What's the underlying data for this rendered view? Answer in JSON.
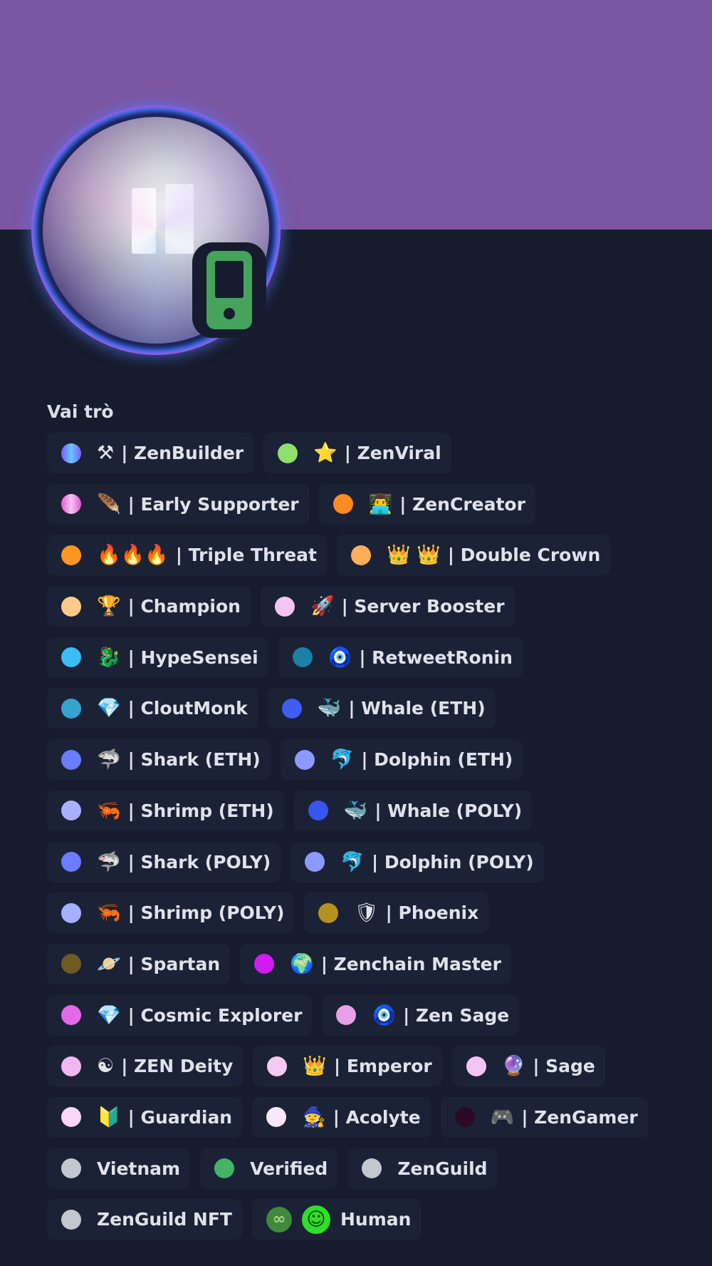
{
  "profile": {
    "section_title": "Vai trò",
    "colors": {
      "banner": "#7c56a0",
      "background": "#161c2d",
      "status_mobile": "#46a35b"
    }
  },
  "roles": [
    {
      "emoji": "⚒",
      "label": "| ZenBuilder",
      "dot": "linear-gradient(90deg,#7c5cff,#66c7ff,#7c5cff)"
    },
    {
      "emoji": "⭐",
      "label": "| ZenViral",
      "dot": "#8fe06a"
    },
    {
      "emoji": "🪶",
      "label": "| Early Supporter",
      "dot": "linear-gradient(90deg,#e45ad6,#f8c4f0,#e45ad6)"
    },
    {
      "emoji": "👨‍💻",
      "label": "| ZenCreator",
      "dot": "#ff8a1e"
    },
    {
      "emoji": "🔥🔥🔥",
      "label": "| Triple Threat",
      "dot": "#ff9523"
    },
    {
      "emoji": "👑 👑",
      "label": "| Double Crown",
      "dot": "#ffae5a"
    },
    {
      "emoji": "🏆",
      "label": "| Champion",
      "dot": "#ffc98a"
    },
    {
      "emoji": "🚀",
      "label": "| Server Booster",
      "dot": "#f5c3f1"
    },
    {
      "emoji": "🐉",
      "label": "| HypeSensei",
      "dot": "#3cbdf4"
    },
    {
      "emoji": "🧿",
      "label": "| RetweetRonin",
      "dot": "#1c7fa6"
    },
    {
      "emoji": "💎",
      "label": "| CloutMonk",
      "dot": "#36a3cf"
    },
    {
      "emoji": "🐳",
      "label": "| Whale (ETH)",
      "dot": "#3f5cf5"
    },
    {
      "emoji": "🦈",
      "label": "| Shark (ETH)",
      "dot": "#6a7cff"
    },
    {
      "emoji": "🐬",
      "label": "| Dolphin (ETH)",
      "dot": "#8c9aff"
    },
    {
      "emoji": "🦐",
      "label": "| Shrimp (ETH)",
      "dot": "#a6b0ff"
    },
    {
      "emoji": "🐳",
      "label": "| Whale (POLY)",
      "dot": "#3a55ee"
    },
    {
      "emoji": "🦈",
      "label": "| Shark (POLY)",
      "dot": "#6a7cff"
    },
    {
      "emoji": "🐬",
      "label": "| Dolphin (POLY)",
      "dot": "#8c9aff"
    },
    {
      "emoji": "🦐",
      "label": "| Shrimp (POLY)",
      "dot": "#a6b0ff"
    },
    {
      "emoji": "🛡",
      "label": "| Phoenix",
      "dot": "#b69020"
    },
    {
      "emoji": "🪐",
      "label": "| Spartan",
      "dot": "#6e5a22"
    },
    {
      "emoji": "🌍",
      "label": "| Zenchain Master",
      "dot": "#d21bf0"
    },
    {
      "emoji": "💎",
      "label": "| Cosmic Explorer",
      "dot": "#e36ae6"
    },
    {
      "emoji": "🧿",
      "label": "| Zen Sage",
      "dot": "#e9a0e8"
    },
    {
      "emoji": "☯",
      "label": "| ZEN Deity",
      "dot": "#f0b7f0"
    },
    {
      "emoji": "👑",
      "label": "| Emperor",
      "dot": "#f4c9f4"
    },
    {
      "emoji": "🔮",
      "label": "| Sage",
      "dot": "#f3c4f2"
    },
    {
      "emoji": "🔰",
      "label": "| Guardian",
      "dot": "#f7d6f7"
    },
    {
      "emoji": "🧙",
      "label": "| Acolyte",
      "dot": "#fae8fa"
    },
    {
      "emoji": "🎮",
      "label": "| ZenGamer",
      "dot": "#2b0a25"
    },
    {
      "emoji": "",
      "label": "Vietnam",
      "dot": "#c3c8cf"
    },
    {
      "emoji": "",
      "label": "Verified",
      "dot": "#43b368"
    },
    {
      "emoji": "",
      "label": "ZenGuild",
      "dot": "#c3c8cf"
    },
    {
      "emoji": "",
      "label": "ZenGuild NFT",
      "dot": "#c3c8cf"
    },
    {
      "emoji": "",
      "label": "Human",
      "dot": ""
    }
  ]
}
